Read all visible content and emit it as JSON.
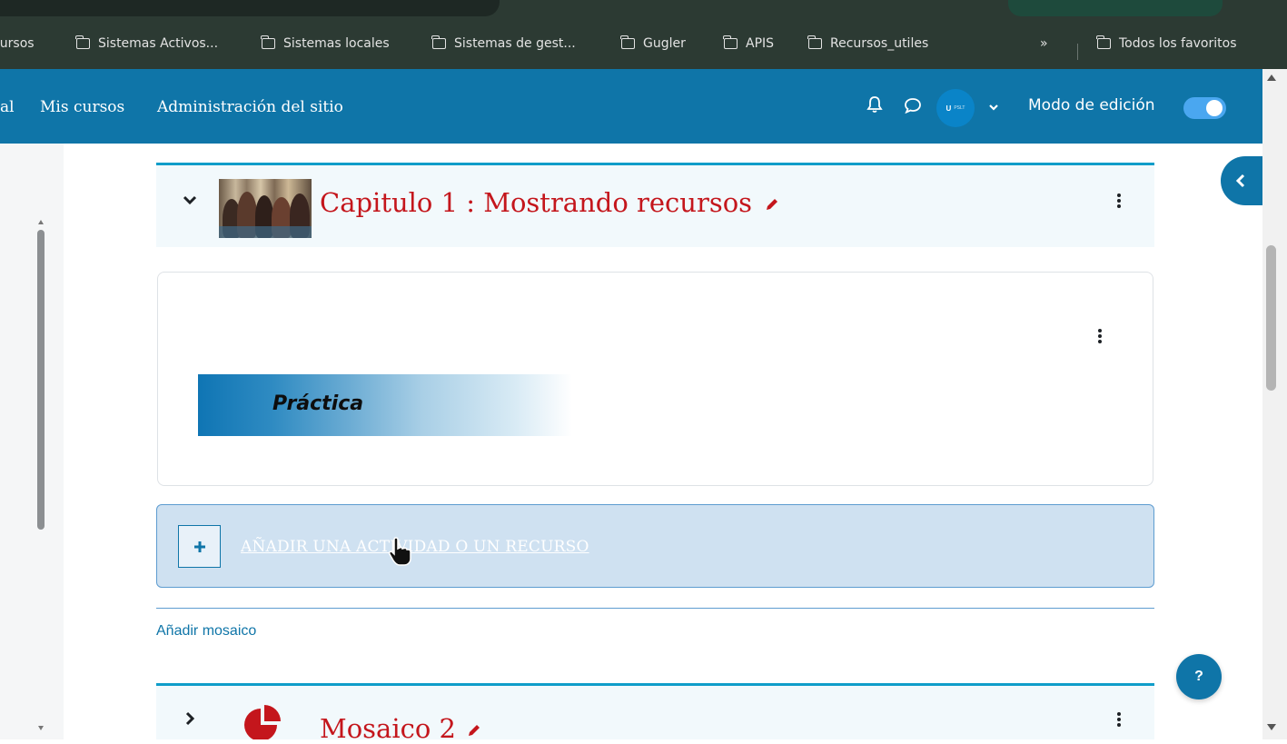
{
  "bookmarks": {
    "items": [
      {
        "label": "Cursos"
      },
      {
        "label": "Sistemas Activos..."
      },
      {
        "label": "Sistemas locales"
      },
      {
        "label": "Sistemas de gest..."
      },
      {
        "label": "Gugler"
      },
      {
        "label": "APIS"
      },
      {
        "label": "Recursos_utiles"
      }
    ],
    "overflow": "»",
    "all_favorites": "Todos los favoritos"
  },
  "navbar": {
    "partial_link": "al",
    "my_courses": "Mis cursos",
    "site_admin": "Administración del sitio",
    "avatar_initials": "U",
    "avatar_sub": "PSLT",
    "edit_mode_label": "Modo de edición",
    "edit_mode_on": true,
    "accent": "#0f75a8"
  },
  "section1": {
    "title": "Capitulo 1 : Mostrando recursos",
    "expanded": true,
    "title_color": "#c4161c"
  },
  "content": {
    "banner_text": "Práctica"
  },
  "add_activity": {
    "label": "AÑADIR UNA ACTIVIDAD O UN RECURSO"
  },
  "add_mosaic": "Añadir mosaico",
  "section2": {
    "title": "Mosaico 2",
    "expanded": false
  },
  "help": "?"
}
